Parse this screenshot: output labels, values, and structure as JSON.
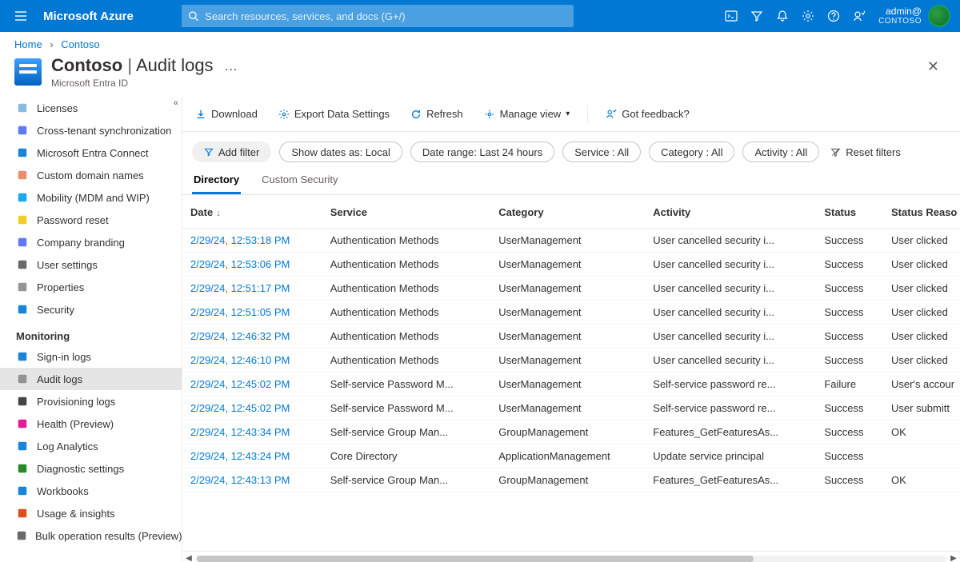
{
  "topbar": {
    "brand": "Microsoft Azure",
    "search_placeholder": "Search resources, services, and docs (G+/)",
    "account_name": "admin@",
    "account_org": "CONTOSO"
  },
  "breadcrumb": {
    "home": "Home",
    "item": "Contoso"
  },
  "page": {
    "title_entity": "Contoso",
    "title_page": "Audit logs",
    "subtitle": "Microsoft Entra ID"
  },
  "toolbar": {
    "download": "Download",
    "export": "Export Data Settings",
    "refresh": "Refresh",
    "manage_view": "Manage view",
    "feedback": "Got feedback?"
  },
  "filters": {
    "add_filter": "Add filter",
    "show_dates": "Show dates as: Local",
    "date_range": "Date range: Last 24 hours",
    "service": "Service : All",
    "category": "Category : All",
    "activity": "Activity : All",
    "reset": "Reset filters"
  },
  "tabs": {
    "directory": "Directory",
    "custom": "Custom Security"
  },
  "sidebar": {
    "items": [
      {
        "icon": "licenses",
        "label": "Licenses",
        "color": "#7ab6e0"
      },
      {
        "icon": "sync",
        "label": "Cross-tenant synchronization",
        "color": "#4f6bed"
      },
      {
        "icon": "connect",
        "label": "Microsoft Entra Connect",
        "color": "#0078d4"
      },
      {
        "icon": "domain",
        "label": "Custom domain names",
        "color": "#e8825d"
      },
      {
        "icon": "mobility",
        "label": "Mobility (MDM and WIP)",
        "color": "#00a2ed"
      },
      {
        "icon": "pwreset",
        "label": "Password reset",
        "color": "#f2c811"
      },
      {
        "icon": "branding",
        "label": "Company branding",
        "color": "#4f6bed"
      },
      {
        "icon": "usersettings",
        "label": "User settings",
        "color": "#5a5a5a"
      },
      {
        "icon": "properties",
        "label": "Properties",
        "color": "#8a8886"
      },
      {
        "icon": "security",
        "label": "Security",
        "color": "#0078d4"
      }
    ],
    "section": "Monitoring",
    "monitoring": [
      {
        "icon": "signin",
        "label": "Sign-in logs",
        "color": "#0078d4"
      },
      {
        "icon": "audit",
        "label": "Audit logs",
        "color": "#8a8886",
        "selected": true
      },
      {
        "icon": "provision",
        "label": "Provisioning logs",
        "color": "#323130"
      },
      {
        "icon": "health",
        "label": "Health (Preview)",
        "color": "#e3008c"
      },
      {
        "icon": "loganalytics",
        "label": "Log Analytics",
        "color": "#0078d4"
      },
      {
        "icon": "diagnostic",
        "label": "Diagnostic settings",
        "color": "#107c10"
      },
      {
        "icon": "workbooks",
        "label": "Workbooks",
        "color": "#0078d4"
      },
      {
        "icon": "usage",
        "label": "Usage & insights",
        "color": "#d83b01"
      },
      {
        "icon": "bulk",
        "label": "Bulk operation results (Preview)",
        "color": "#5a5a5a"
      }
    ]
  },
  "columns": [
    "Date",
    "Service",
    "Category",
    "Activity",
    "Status",
    "Status Reaso"
  ],
  "rows": [
    {
      "date": "2/29/24, 12:53:18 PM",
      "service": "Authentication Methods",
      "category": "UserManagement",
      "activity": "User cancelled security i...",
      "status": "Success",
      "reason": "User clicked "
    },
    {
      "date": "2/29/24, 12:53:06 PM",
      "service": "Authentication Methods",
      "category": "UserManagement",
      "activity": "User cancelled security i...",
      "status": "Success",
      "reason": "User clicked "
    },
    {
      "date": "2/29/24, 12:51:17 PM",
      "service": "Authentication Methods",
      "category": "UserManagement",
      "activity": "User cancelled security i...",
      "status": "Success",
      "reason": "User clicked "
    },
    {
      "date": "2/29/24, 12:51:05 PM",
      "service": "Authentication Methods",
      "category": "UserManagement",
      "activity": "User cancelled security i...",
      "status": "Success",
      "reason": "User clicked "
    },
    {
      "date": "2/29/24, 12:46:32 PM",
      "service": "Authentication Methods",
      "category": "UserManagement",
      "activity": "User cancelled security i...",
      "status": "Success",
      "reason": "User clicked "
    },
    {
      "date": "2/29/24, 12:46:10 PM",
      "service": "Authentication Methods",
      "category": "UserManagement",
      "activity": "User cancelled security i...",
      "status": "Success",
      "reason": "User clicked "
    },
    {
      "date": "2/29/24, 12:45:02 PM",
      "service": "Self-service Password M...",
      "category": "UserManagement",
      "activity": "Self-service password re...",
      "status": "Failure",
      "reason": "User's accour"
    },
    {
      "date": "2/29/24, 12:45:02 PM",
      "service": "Self-service Password M...",
      "category": "UserManagement",
      "activity": "Self-service password re...",
      "status": "Success",
      "reason": "User submitt"
    },
    {
      "date": "2/29/24, 12:43:34 PM",
      "service": "Self-service Group Man...",
      "category": "GroupManagement",
      "activity": "Features_GetFeaturesAs...",
      "status": "Success",
      "reason": "OK"
    },
    {
      "date": "2/29/24, 12:43:24 PM",
      "service": "Core Directory",
      "category": "ApplicationManagement",
      "activity": "Update service principal",
      "status": "Success",
      "reason": ""
    },
    {
      "date": "2/29/24, 12:43:13 PM",
      "service": "Self-service Group Man...",
      "category": "GroupManagement",
      "activity": "Features_GetFeaturesAs...",
      "status": "Success",
      "reason": "OK"
    }
  ]
}
